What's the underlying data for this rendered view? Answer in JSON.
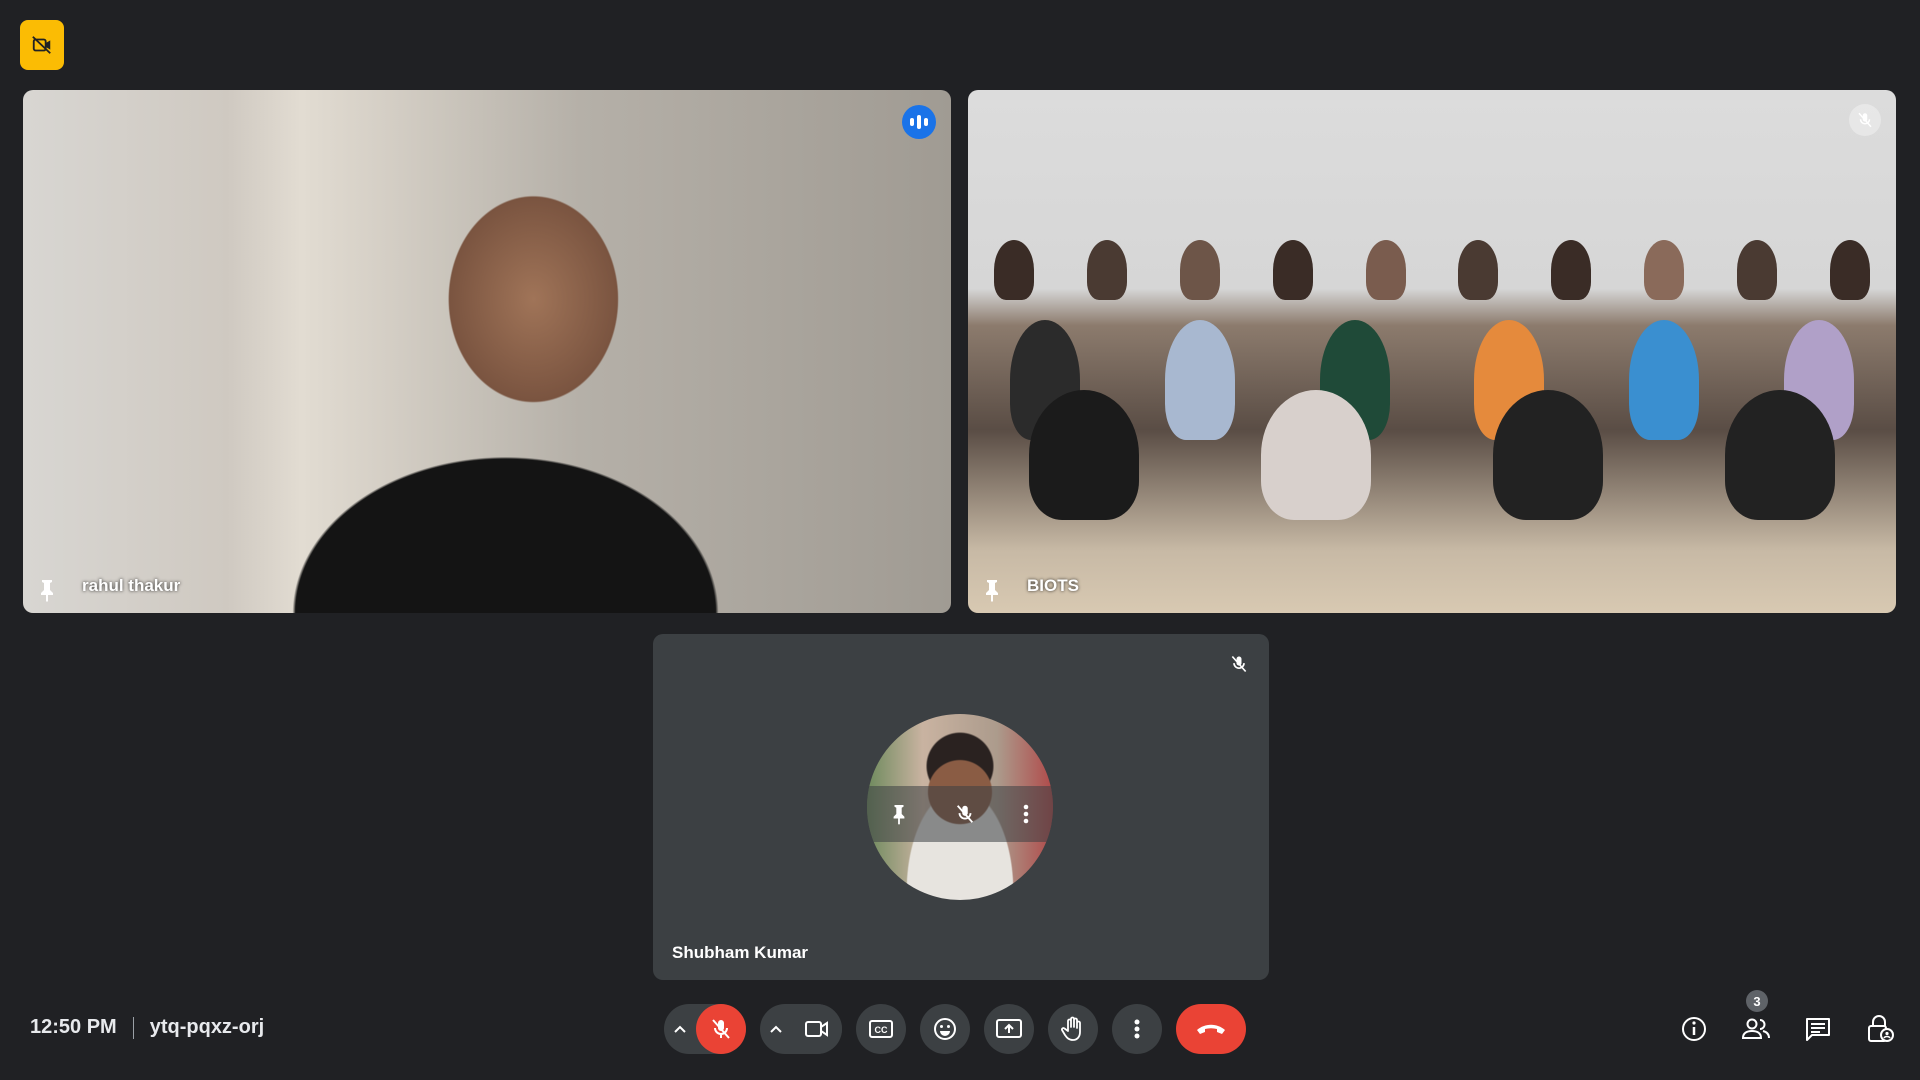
{
  "meeting": {
    "time": "12:50 PM",
    "code": "ytq-pqxz-orj"
  },
  "participants": [
    {
      "name": "rahul thakur",
      "state": "speaking",
      "pinned_icon": "pin-icon"
    },
    {
      "name": "BIOTS",
      "state": "muted",
      "pinned_icon": "pin-icon"
    },
    {
      "name": "Shubham Kumar",
      "state": "muted",
      "video": "off"
    }
  ],
  "controls": {
    "mic": {
      "icon": "mic-off-icon",
      "state": "off"
    },
    "camera": {
      "icon": "video-camera-icon"
    },
    "captions": {
      "icon": "closed-captions-icon"
    },
    "reactions": {
      "icon": "emoji-icon"
    },
    "present": {
      "icon": "present-screen-icon"
    },
    "raise_hand": {
      "icon": "raise-hand-icon"
    },
    "more": {
      "icon": "more-options-icon"
    },
    "leave": {
      "icon": "end-call-icon"
    }
  },
  "side_panel_buttons": {
    "people_count": "3"
  },
  "colors": {
    "background": "#202124",
    "tile": "#3c4043",
    "accent_blue": "#1a73e8",
    "danger_red": "#ea4335",
    "recording_yellow": "#fbbc04"
  }
}
